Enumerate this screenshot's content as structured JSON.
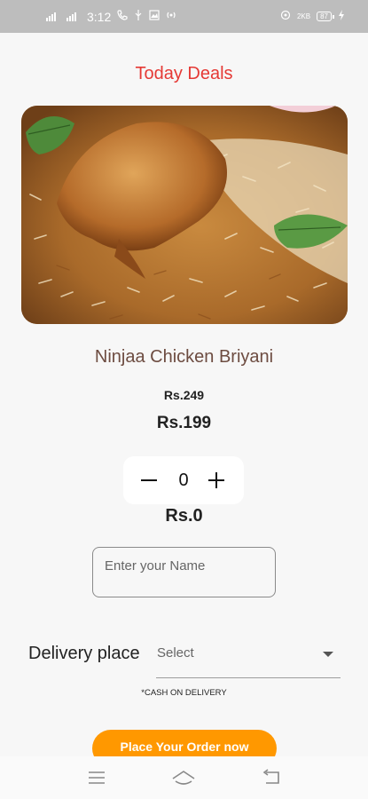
{
  "status_bar": {
    "network_left": "4G",
    "network_left2": "4G",
    "time": "3:12",
    "speed": "2KB/s",
    "battery": "87"
  },
  "page": {
    "title": "Today Deals"
  },
  "product": {
    "name": "Ninjaa Chicken Briyani",
    "old_price": "Rs.249",
    "price": "Rs.199",
    "quantity": "0",
    "total": "Rs.0",
    "image_icon": "biryani-photo"
  },
  "form": {
    "name_placeholder": "Enter your Name",
    "name_value": "",
    "delivery_label": "Delivery place",
    "delivery_selected": "Select",
    "payment_note": "*CASH ON DELIVERY",
    "order_button": "Place Your Order now"
  },
  "colors": {
    "title": "#e53935",
    "dish_name": "#6d4c41",
    "order_button": "#ff9800",
    "status_bar": "#bdbdbd"
  },
  "nav_bar": {
    "icons": [
      "menu-icon",
      "home-icon",
      "back-icon"
    ]
  }
}
